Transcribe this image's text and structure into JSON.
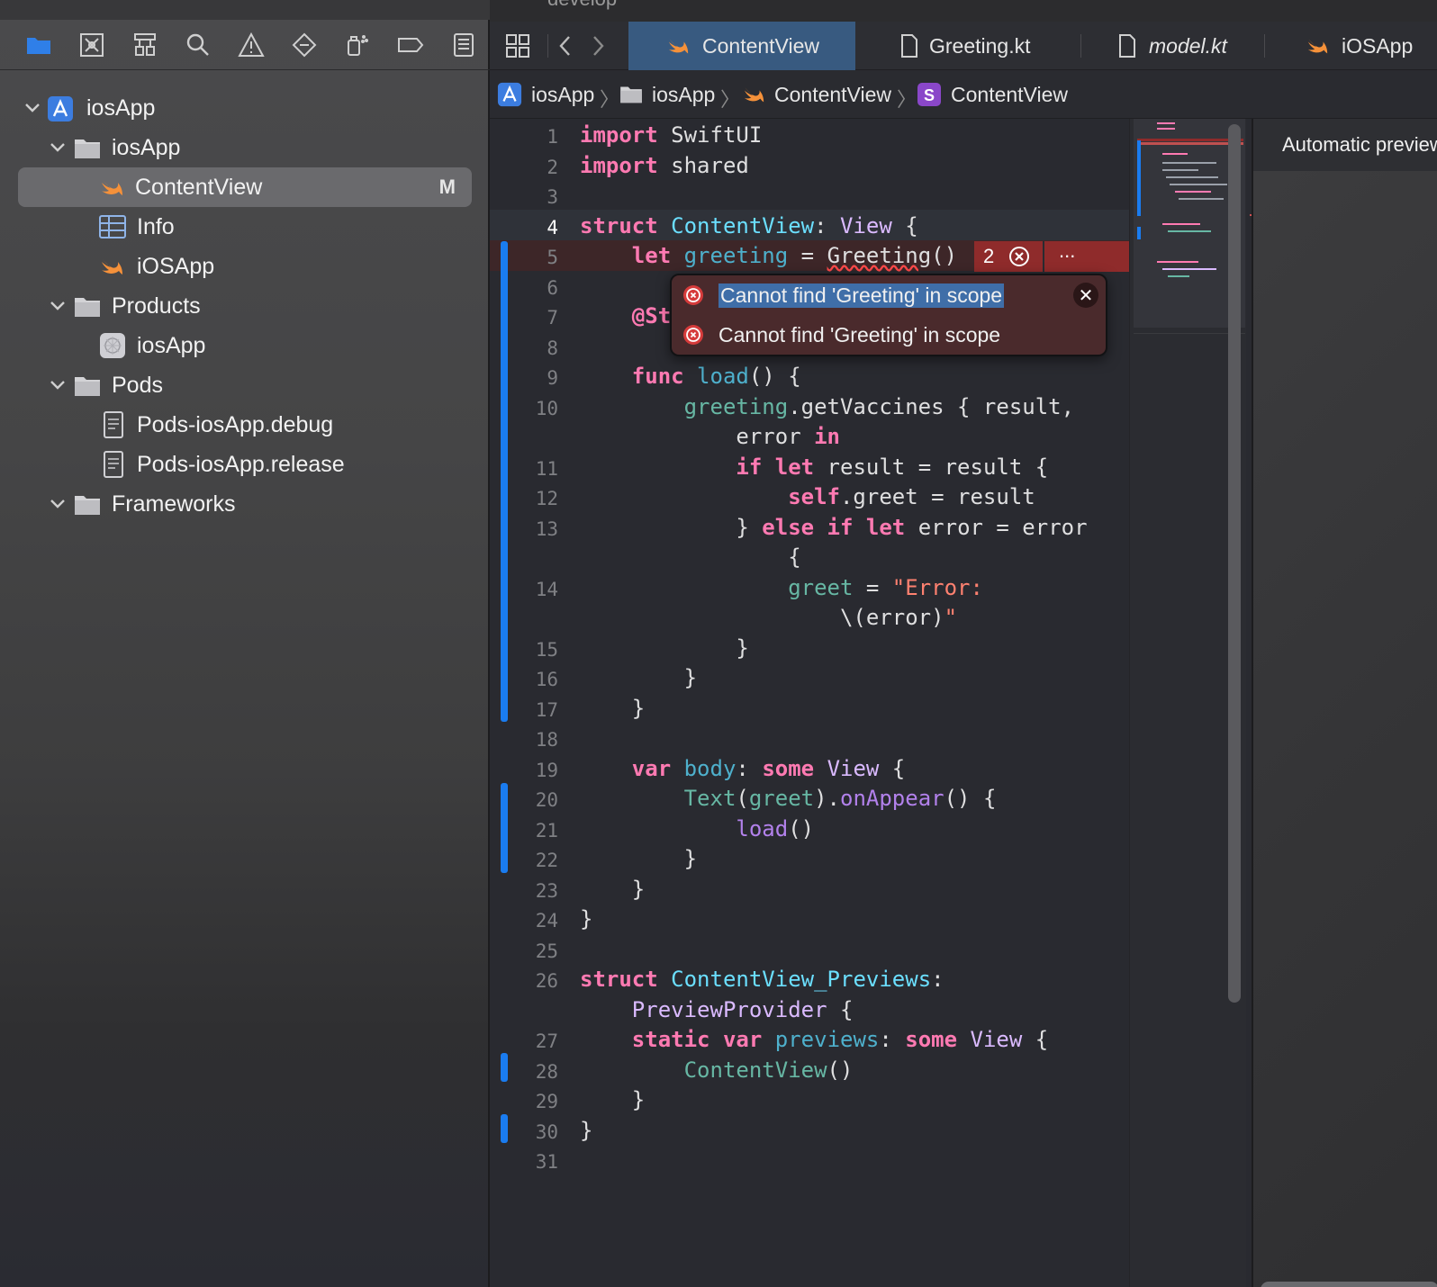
{
  "window": {
    "branch": "develop"
  },
  "navigator": {
    "icons": [
      "folder-icon",
      "source-control-icon",
      "hierarchy-icon",
      "search-icon",
      "warning-icon",
      "test-diamond-icon",
      "debug-spray-icon",
      "breakpoint-icon",
      "report-icon"
    ],
    "items": [
      {
        "label": "iosApp",
        "kind": "project"
      },
      {
        "label": "iosApp",
        "kind": "folder"
      },
      {
        "label": "ContentView",
        "kind": "swift",
        "badge": "M",
        "selected": true
      },
      {
        "label": "Info",
        "kind": "plist"
      },
      {
        "label": "iOSApp",
        "kind": "swift"
      },
      {
        "label": "Products",
        "kind": "folder"
      },
      {
        "label": "iosApp",
        "kind": "app"
      },
      {
        "label": "Pods",
        "kind": "folder"
      },
      {
        "label": "Pods-iosApp.debug",
        "kind": "xcconfig"
      },
      {
        "label": "Pods-iosApp.release",
        "kind": "xcconfig"
      },
      {
        "label": "Frameworks",
        "kind": "folder"
      }
    ]
  },
  "tabs": [
    {
      "label": "ContentView",
      "active": true
    },
    {
      "label": "Greeting.kt"
    },
    {
      "label": "model.kt"
    },
    {
      "label": "iOSApp"
    }
  ],
  "breadcrumb": [
    "iosApp",
    "iosApp",
    "ContentView",
    "ContentView"
  ],
  "editor": {
    "current_line": "4",
    "error_count": "2",
    "more_label": "...",
    "line_numbers": [
      "1",
      "2",
      "3",
      "4",
      "5",
      "6",
      "7",
      "8",
      "9",
      "10",
      "11",
      "12",
      "13",
      "14",
      "15",
      "16",
      "17",
      "18",
      "19",
      "20",
      "21",
      "22",
      "23",
      "24",
      "25",
      "26",
      "27",
      "28",
      "29",
      "30",
      "31"
    ]
  },
  "popover": {
    "messages": [
      "Cannot find 'Greeting' in scope",
      "Cannot find 'Greeting' in scope"
    ],
    "close_label": "✕"
  },
  "preview": {
    "title": "Automatic preview"
  },
  "colors": {
    "accent": "#1a7cf0",
    "error": "#8f2b2b",
    "active_tab": "#385a80",
    "keyword": "#ff7ab2"
  }
}
